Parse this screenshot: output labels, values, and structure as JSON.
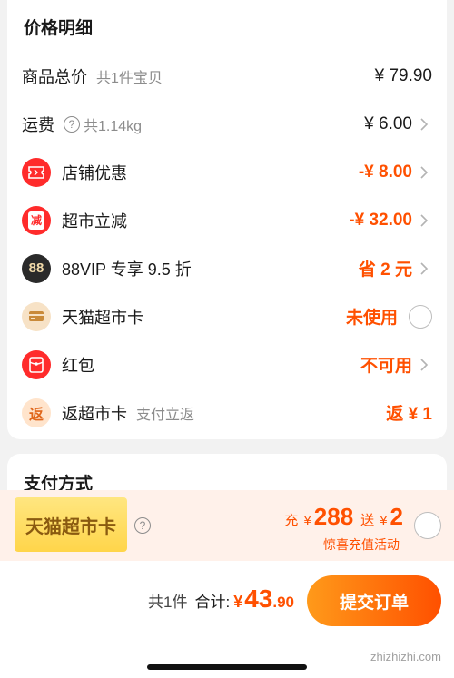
{
  "price_detail": {
    "title": "价格明细",
    "rows": [
      {
        "label": "商品总价",
        "sub": "共1件宝贝",
        "value": "¥ 79.90"
      },
      {
        "label": "运费",
        "sub": "共1.14kg",
        "value": "¥ 6.00"
      },
      {
        "label": "店铺优惠",
        "value": "-¥ 8.00"
      },
      {
        "label": "超市立减",
        "value": "-¥ 32.00",
        "icon_text": "减"
      },
      {
        "label": "88VIP 专享 9.5 折",
        "value": "省 2 元",
        "icon_text": "88"
      },
      {
        "label": "天猫超市卡",
        "value": "未使用"
      },
      {
        "label": "红包",
        "value": "不可用"
      },
      {
        "label": "返超市卡",
        "sub": "支付立返",
        "value": "返 ¥ 1",
        "icon_text": "返"
      }
    ]
  },
  "payment": {
    "title": "支付方式",
    "card_label": "天猫超市卡",
    "promo": {
      "charge_prefix": "充",
      "charge_currency": "¥",
      "charge_amount": "288",
      "gift_prefix": "送",
      "gift_currency": "¥",
      "gift_amount": "2",
      "subtitle": "惊喜充值活动"
    }
  },
  "footer": {
    "count": "共1件",
    "total_label": "合计:",
    "currency": "¥",
    "total_int": "43",
    "total_dec": ".90",
    "submit_label": "提交订单"
  },
  "watermark": "zhizhizhi.com",
  "colors": {
    "accent": "#ff5000",
    "text": "#1a1a1a",
    "muted": "#8c8c8c",
    "promo_bg": "#fff1ea"
  }
}
